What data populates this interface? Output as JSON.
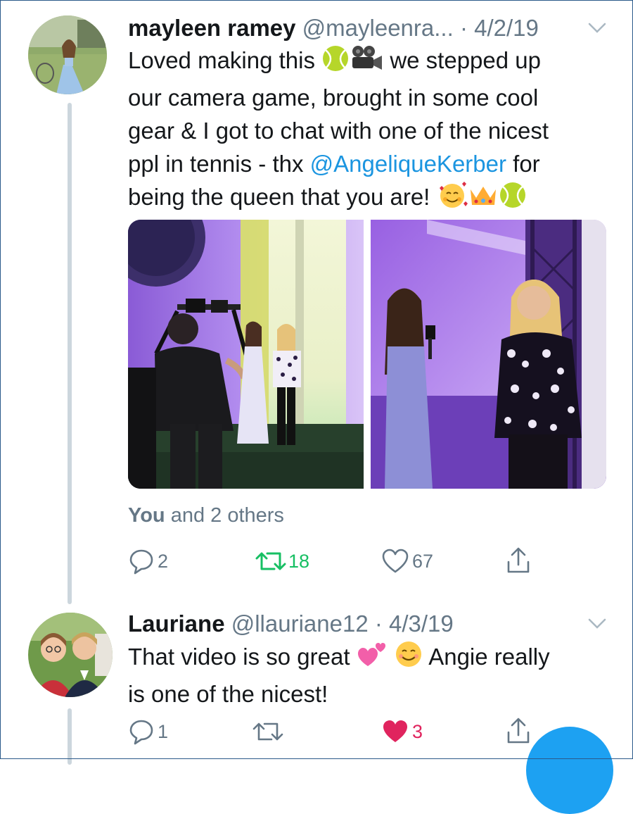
{
  "tweets": [
    {
      "name": "mayleen ramey",
      "handle": "@mayleenra...",
      "date": "· 4/2/19",
      "text": {
        "line1_pre": "Loved making this",
        "line1_post": "we stepped up",
        "line2": "our camera game, brought in some cool",
        "line3": "gear & I got to chat with one of the nicest",
        "line4_pre": "ppl in tennis - thx",
        "mention": "@AngeliqueKerber",
        "line4_post": "for",
        "line5": "being the queen that you are!"
      },
      "emoji_line1": [
        "tennis-ball",
        "movie-camera"
      ],
      "emoji_line5": [
        "smiling-face-with-hearts",
        "crown",
        "tennis-ball"
      ],
      "liked_by_you": "You",
      "liked_by_rest": "and 2 others",
      "replies": "2",
      "retweets": "18",
      "likes": "67",
      "retweeted": true,
      "liked": false
    },
    {
      "name": "Lauriane",
      "handle": "@llauriane12",
      "date": "· 4/3/19",
      "text": {
        "line1_pre": "That video is so great",
        "line1_post": "Angie really",
        "line2": "is one of the nicest!"
      },
      "emoji_line1": [
        "two-hearts",
        "smiling-face"
      ],
      "replies": "1",
      "retweets": "",
      "likes": "3",
      "liked": true
    }
  ],
  "colors": {
    "text": "#14171a",
    "meta": "#657786",
    "link": "#1b95e0",
    "retweet_green": "#17bf63",
    "like_red": "#e0245e",
    "accent": "#1da1f2"
  }
}
